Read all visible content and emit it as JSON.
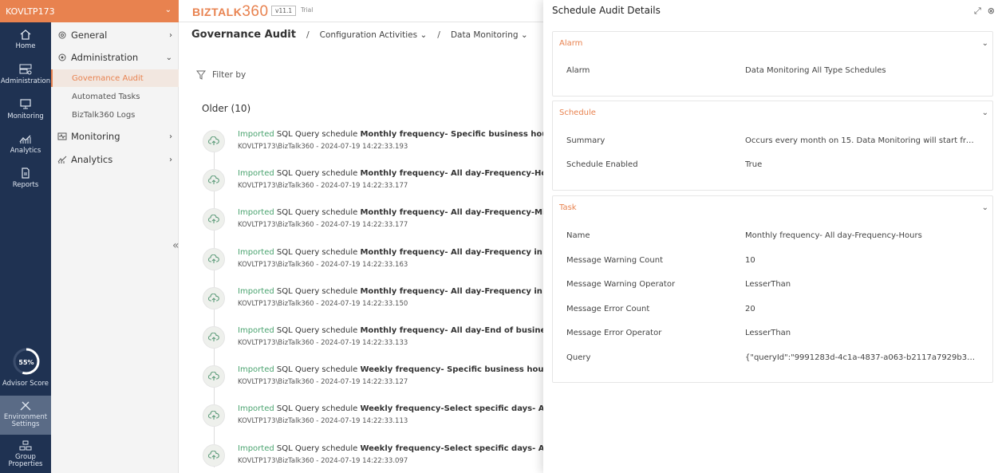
{
  "env": {
    "name": "KOVLTP173"
  },
  "rail": {
    "items": [
      {
        "label": "Home"
      },
      {
        "label": "Administration"
      },
      {
        "label": "Monitoring"
      },
      {
        "label": "Analytics"
      },
      {
        "label": "Reports"
      }
    ],
    "advisor": {
      "percent": "55%",
      "label": "Advisor Score",
      "value": 0.55
    },
    "env_settings": "Environment Settings",
    "group_props": "Group Properties"
  },
  "submenu": {
    "general": "General",
    "administration": "Administration",
    "admin_items": [
      "Governance Audit",
      "Automated Tasks",
      "BizTalk360 Logs"
    ],
    "monitoring": "Monitoring",
    "analytics": "Analytics"
  },
  "topbar": {
    "logo_text": "BIZTALK",
    "logo_num": "360",
    "version": "v11.1",
    "trial": "Trial"
  },
  "breadcrumb": {
    "title": "Governance Audit",
    "level2": "Configuration Activities",
    "level3": "Data Monitoring"
  },
  "filter": {
    "label": "Filter by"
  },
  "list": {
    "section": "Older (10)",
    "items": [
      {
        "status": "Imported",
        "kind": "SQL Query schedule",
        "name": "Monthly frequency- Specific business hours",
        "meta": "KOVLTP173\\BizTalk360 - 2024-07-19 14:22:33.193"
      },
      {
        "status": "Imported",
        "kind": "SQL Query schedule",
        "name": "Monthly frequency- All day-Frequency-Hours",
        "meta": "KOVLTP173\\BizTalk360 - 2024-07-19 14:22:33.177"
      },
      {
        "status": "Imported",
        "kind": "SQL Query schedule",
        "name": "Monthly frequency- All day-Frequency-Minutes",
        "meta": "KOVLTP173\\BizTalk360 - 2024-07-19 14:22:33.177"
      },
      {
        "status": "Imported",
        "kind": "SQL Query schedule",
        "name": "Monthly frequency- All day-Frequency in hours w",
        "meta": "KOVLTP173\\BizTalk360 - 2024-07-19 14:22:33.163"
      },
      {
        "status": "Imported",
        "kind": "SQL Query schedule",
        "name": "Monthly frequency- All day-Frequency in hours w",
        "meta": "KOVLTP173\\BizTalk360 - 2024-07-19 14:22:33.150"
      },
      {
        "status": "Imported",
        "kind": "SQL Query schedule",
        "name": "Monthly frequency- All day-End of business day",
        "meta": "KOVLTP173\\BizTalk360 - 2024-07-19 14:22:33.133"
      },
      {
        "status": "Imported",
        "kind": "SQL Query schedule",
        "name": "Weekly frequency- Specific business hours",
        "meta": "KOVLTP173\\BizTalk360 - 2024-07-19 14:22:33.127"
      },
      {
        "status": "Imported",
        "kind": "SQL Query schedule",
        "name": "Weekly frequency-Select specific days- All day-F",
        "meta": "KOVLTP173\\BizTalk360 - 2024-07-19 14:22:33.113"
      },
      {
        "status": "Imported",
        "kind": "SQL Query schedule",
        "name": "Weekly frequency-Select specific days- All day-F",
        "meta": "KOVLTP173\\BizTalk360 - 2024-07-19 14:22:33.097"
      }
    ]
  },
  "panel": {
    "title": "Schedule Audit Details",
    "alarm": {
      "title": "Alarm",
      "rows": [
        {
          "label": "Alarm",
          "value": "Data Monitoring All Type Schedules"
        }
      ]
    },
    "schedule": {
      "title": "Schedule",
      "rows": [
        {
          "label": "Summary",
          "value": "Occurs every month on 15. Data Monitoring will start from ..."
        },
        {
          "label": "Schedule Enabled",
          "value": "True"
        }
      ]
    },
    "task": {
      "title": "Task",
      "rows": [
        {
          "label": "Name",
          "value": "Monthly frequency- All day-Frequency-Hours"
        },
        {
          "label": "Message Warning Count",
          "value": "10"
        },
        {
          "label": "Message Warning Operator",
          "value": "LesserThan"
        },
        {
          "label": "Message Error Count",
          "value": "20"
        },
        {
          "label": "Message Error Operator",
          "value": "LesserThan"
        },
        {
          "label": "Query",
          "value": "{\"queryId\":\"9991283d-4c1a-4837-a063-b2117a7929b3\",\"..."
        }
      ]
    }
  }
}
